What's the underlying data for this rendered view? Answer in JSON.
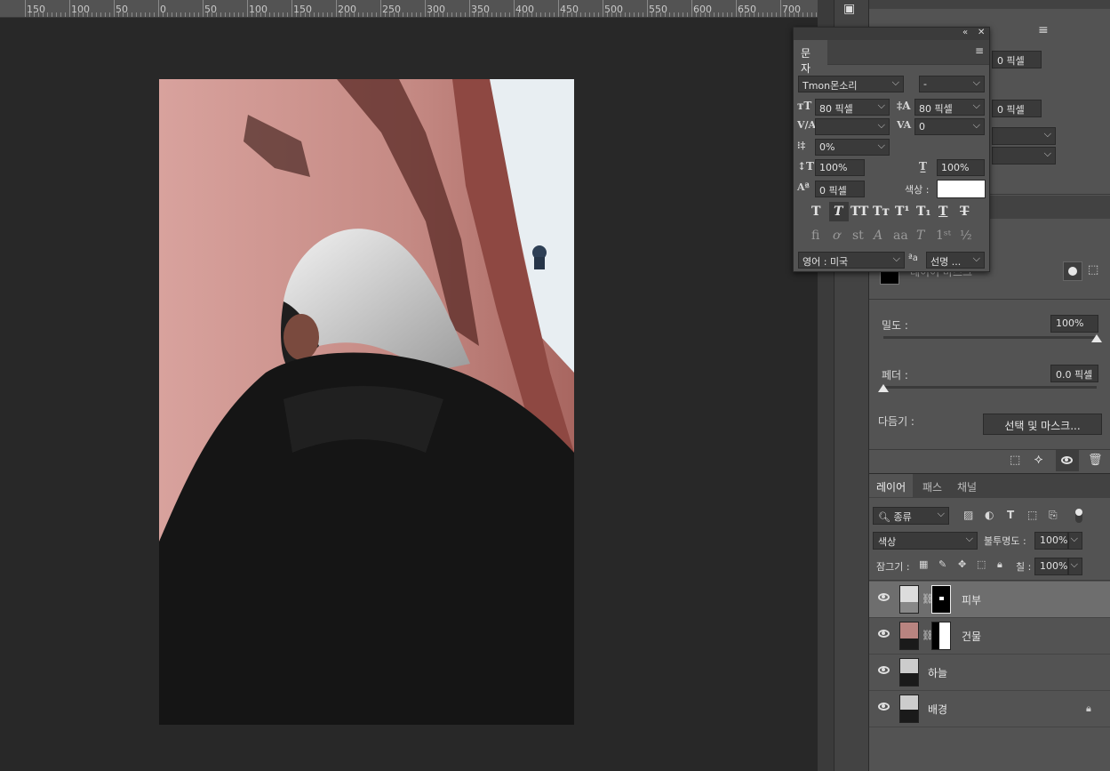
{
  "ruler": {
    "ticks": [
      "150",
      "100",
      "50",
      "0",
      "50",
      "100",
      "150",
      "200",
      "250",
      "300",
      "350",
      "400",
      "450",
      "500",
      "550",
      "600",
      "650",
      "700"
    ]
  },
  "character_panel": {
    "tab": "문자",
    "font_family": "Tmon몬소리",
    "font_style": "-",
    "font_size": "80 픽셀",
    "leading": "80 픽셀",
    "kerning": "",
    "tracking": "0",
    "tsume": "0%",
    "vertical_scale": "100%",
    "horizontal_scale": "100%",
    "baseline_shift": "0 픽셀",
    "color_label": "색상 :",
    "color_value": "#ffffff",
    "language": "영어 : 미국",
    "aa_label": "ªa",
    "antialias": "선명 ..."
  },
  "paragraph_partial": {
    "indent_1": "0 픽셀",
    "indent_2": "0 픽셀"
  },
  "properties": {
    "mask_label": "레이어 마스크",
    "density_label": "밀도 :",
    "density_value": "100%",
    "density_fraction": 1.0,
    "feather_label": "페더 :",
    "feather_value": "0.0 픽셀",
    "feather_fraction": 0.0,
    "refine_label": "다듬기 :",
    "refine_button": "선택 및 마스크..."
  },
  "layers_panel": {
    "tabs": [
      "레이어",
      "패스",
      "채널"
    ],
    "filter_kind": "종류",
    "blend_mode": "색상",
    "opacity_label": "불투명도 :",
    "opacity_value": "100%",
    "lock_label": "잠그기 :",
    "fill_label": "칠 :",
    "fill_value": "100%",
    "layers": [
      {
        "name": "피부",
        "selected": true,
        "has_mask": true,
        "locked": false
      },
      {
        "name": "건물",
        "selected": false,
        "has_mask": true,
        "locked": false
      },
      {
        "name": "하늘",
        "selected": false,
        "has_mask": false,
        "locked": false
      },
      {
        "name": "배경",
        "selected": false,
        "has_mask": false,
        "locked": true
      }
    ]
  }
}
